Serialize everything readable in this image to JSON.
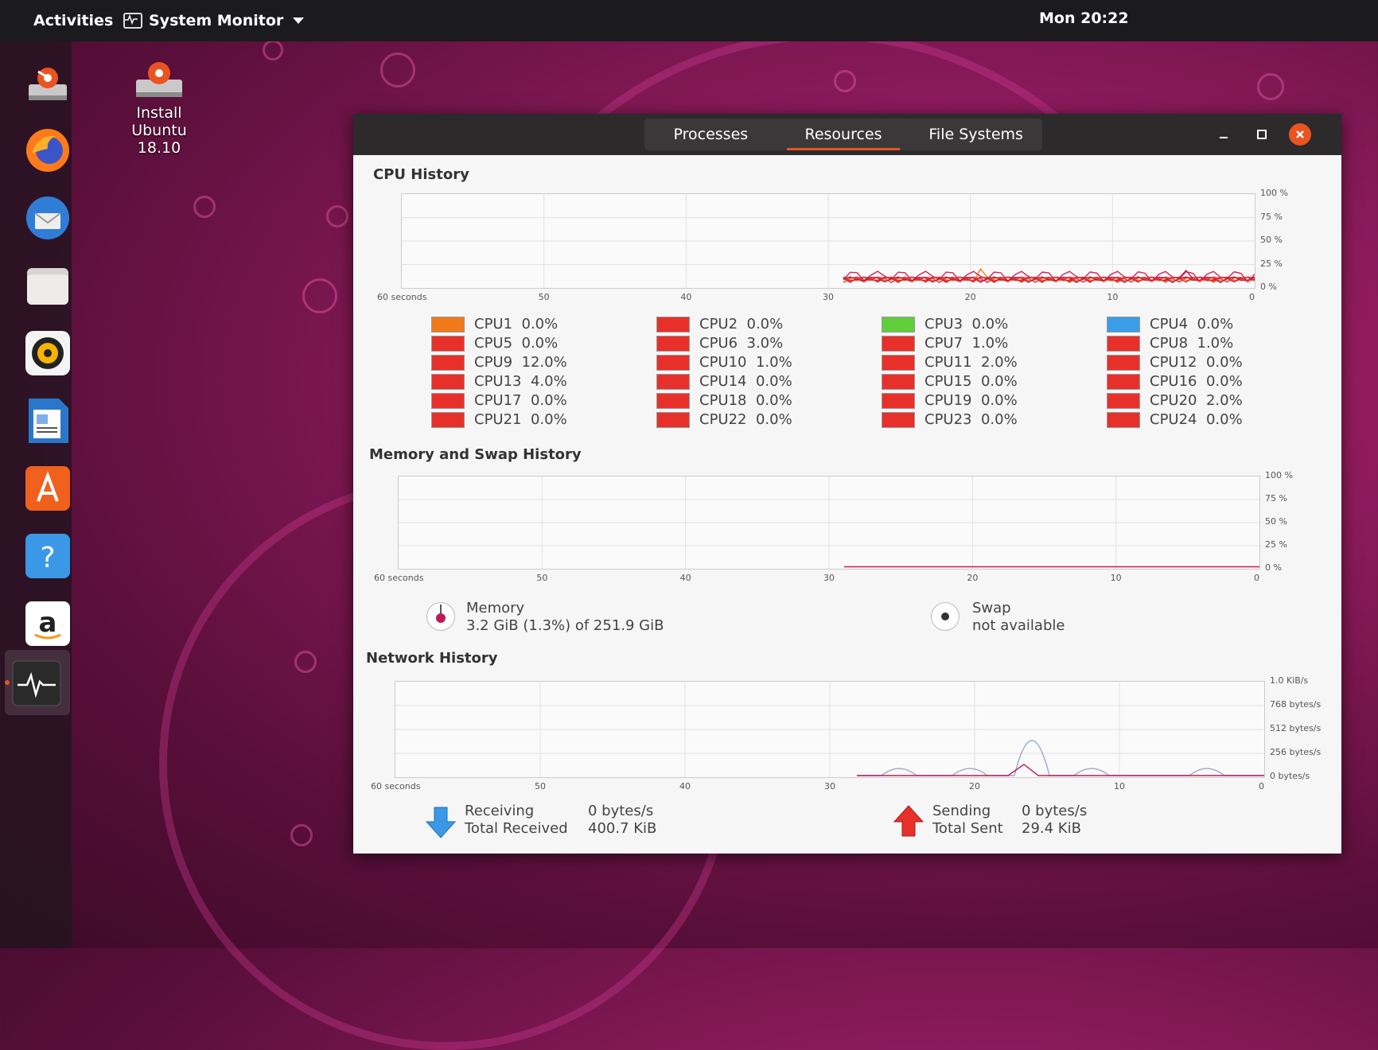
{
  "topbar": {
    "activities": "Activities",
    "app_name": "System Monitor",
    "clock": "Mon 20:22"
  },
  "desktop_icon": {
    "line1": "Install",
    "line2": "Ubuntu",
    "line3": "18.10"
  },
  "dock": [
    {
      "name": "installer-icon"
    },
    {
      "name": "firefox-icon"
    },
    {
      "name": "thunderbird-icon"
    },
    {
      "name": "files-icon"
    },
    {
      "name": "rhythmbox-icon"
    },
    {
      "name": "writer-icon"
    },
    {
      "name": "software-icon"
    },
    {
      "name": "help-icon"
    },
    {
      "name": "amazon-icon"
    },
    {
      "name": "system-monitor-icon"
    }
  ],
  "tabs": [
    "Processes",
    "Resources",
    "File Systems"
  ],
  "active_tab": "Resources",
  "cpu": {
    "title": "CPU History",
    "y_ticks": [
      "100 %",
      "75 %",
      "50 %",
      "25 %",
      "0 %"
    ],
    "x_ticks": [
      "60 seconds",
      "50",
      "40",
      "30",
      "20",
      "10",
      "0"
    ],
    "items": [
      {
        "label": "CPU1",
        "value": "0.0%",
        "color": "#f07a1a"
      },
      {
        "label": "CPU2",
        "value": "0.0%",
        "color": "#e8302a"
      },
      {
        "label": "CPU3",
        "value": "0.0%",
        "color": "#5fcf3c"
      },
      {
        "label": "CPU4",
        "value": "0.0%",
        "color": "#3a9ee8"
      },
      {
        "label": "CPU5",
        "value": "0.0%",
        "color": "#e8302a"
      },
      {
        "label": "CPU6",
        "value": "3.0%",
        "color": "#e8302a"
      },
      {
        "label": "CPU7",
        "value": "1.0%",
        "color": "#e8302a"
      },
      {
        "label": "CPU8",
        "value": "1.0%",
        "color": "#e8302a"
      },
      {
        "label": "CPU9",
        "value": "12.0%",
        "color": "#e8302a"
      },
      {
        "label": "CPU10",
        "value": "1.0%",
        "color": "#e8302a"
      },
      {
        "label": "CPU11",
        "value": "2.0%",
        "color": "#e8302a"
      },
      {
        "label": "CPU12",
        "value": "0.0%",
        "color": "#e8302a"
      },
      {
        "label": "CPU13",
        "value": "4.0%",
        "color": "#e8302a"
      },
      {
        "label": "CPU14",
        "value": "0.0%",
        "color": "#e8302a"
      },
      {
        "label": "CPU15",
        "value": "0.0%",
        "color": "#e8302a"
      },
      {
        "label": "CPU16",
        "value": "0.0%",
        "color": "#e8302a"
      },
      {
        "label": "CPU17",
        "value": "0.0%",
        "color": "#e8302a"
      },
      {
        "label": "CPU18",
        "value": "0.0%",
        "color": "#e8302a"
      },
      {
        "label": "CPU19",
        "value": "0.0%",
        "color": "#e8302a"
      },
      {
        "label": "CPU20",
        "value": "2.0%",
        "color": "#e8302a"
      },
      {
        "label": "CPU21",
        "value": "0.0%",
        "color": "#e8302a"
      },
      {
        "label": "CPU22",
        "value": "0.0%",
        "color": "#e8302a"
      },
      {
        "label": "CPU23",
        "value": "0.0%",
        "color": "#e8302a"
      },
      {
        "label": "CPU24",
        "value": "0.0%",
        "color": "#e8302a"
      }
    ]
  },
  "memory": {
    "title": "Memory and Swap History",
    "y_ticks": [
      "100 %",
      "75 %",
      "50 %",
      "25 %",
      "0 %"
    ],
    "x_ticks": [
      "60 seconds",
      "50",
      "40",
      "30",
      "20",
      "10",
      "0"
    ],
    "mem_label": "Memory",
    "mem_value": "3.2 GiB (1.3%) of 251.9 GiB",
    "swap_label": "Swap",
    "swap_value": "not available"
  },
  "network": {
    "title": "Network History",
    "y_ticks": [
      "1.0 KiB/s",
      "768 bytes/s",
      "512 bytes/s",
      "256 bytes/s",
      "0 bytes/s"
    ],
    "x_ticks": [
      "60 seconds",
      "50",
      "40",
      "30",
      "20",
      "10",
      "0"
    ],
    "receiving_label": "Receiving",
    "receiving_value": "0 bytes/s",
    "total_received_label": "Total Received",
    "total_received_value": "400.7 KiB",
    "sending_label": "Sending",
    "sending_value": "0 bytes/s",
    "total_sent_label": "Total Sent",
    "total_sent_value": "29.4 KiB"
  },
  "colors": {
    "accent": "#e95420",
    "memory": "#c2185b",
    "network": "#c2185b"
  }
}
